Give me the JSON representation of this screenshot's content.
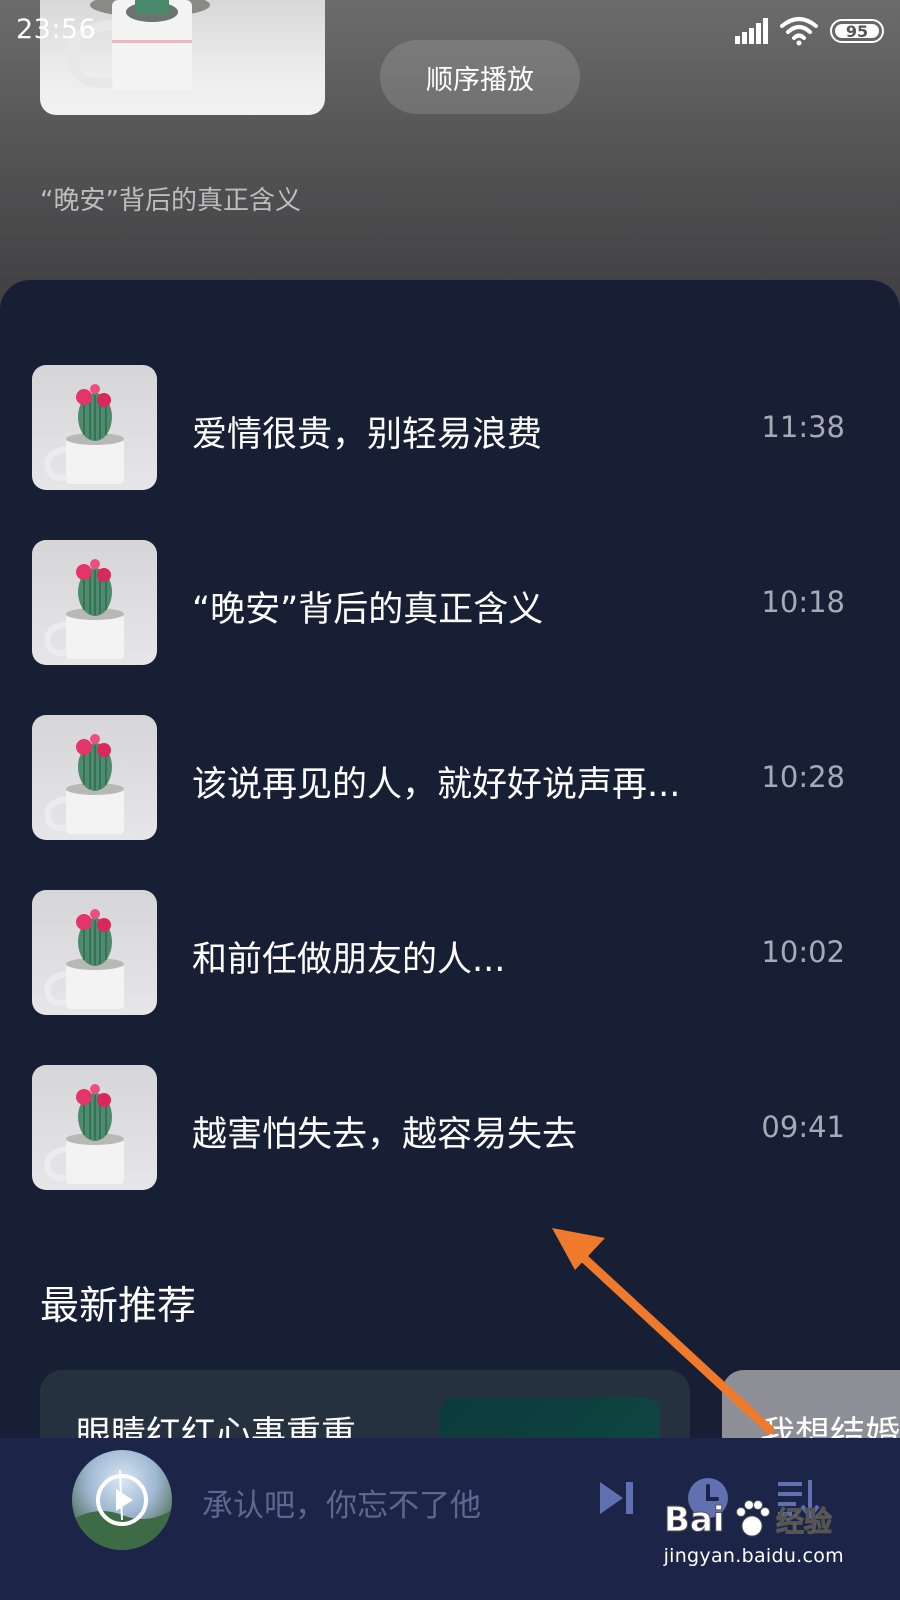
{
  "status_bar": {
    "time": "23:56",
    "battery": "95"
  },
  "header": {
    "play_order_label": "顺序播放",
    "current_episode": "“晚安”背后的真正含义"
  },
  "playlist": {
    "items": [
      {
        "title": "爱情很贵，别轻易浪费",
        "duration": "11:38"
      },
      {
        "title": "“晚安”背后的真正含义",
        "duration": "10:18"
      },
      {
        "title": "该说再见的人，就好好说声再...",
        "duration": "10:28"
      },
      {
        "title": "和前任做朋友的人...",
        "duration": "10:02"
      },
      {
        "title": "越害怕失去，越容易失去",
        "duration": "09:41"
      }
    ]
  },
  "recommend": {
    "heading": "最新推荐",
    "cards": [
      {
        "title": "眼睛红红心事重重"
      },
      {
        "title": "我想结婚"
      }
    ]
  },
  "mini_player": {
    "title": "承认吧，你忘不了他"
  },
  "watermark": {
    "brand": "Bai 经验",
    "url": "jingyan.baidu.com"
  },
  "colors": {
    "sheet_bg": "#171f35",
    "player_bg": "#1c2548",
    "accent_player_icons": "#6170b0",
    "arrow": "#f07a2c"
  },
  "icons": [
    "signal-icon",
    "wifi-icon",
    "battery-icon",
    "play-icon",
    "next-icon",
    "timer-icon",
    "playlist-icon",
    "paw-icon"
  ]
}
